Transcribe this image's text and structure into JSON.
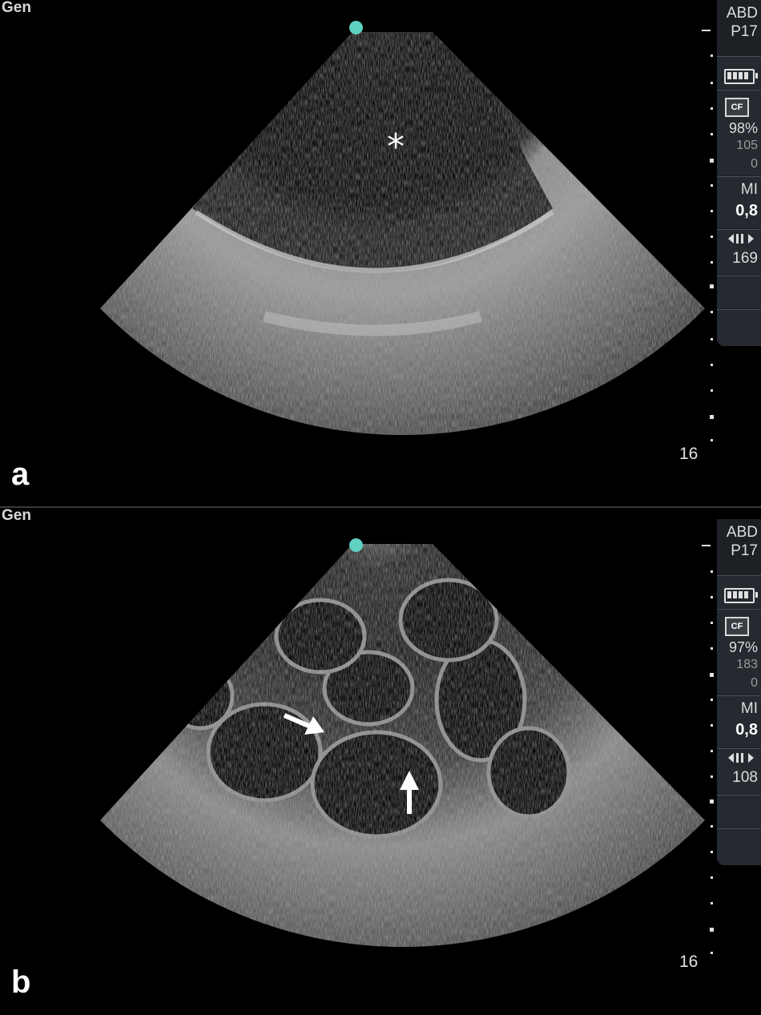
{
  "panels": [
    {
      "letter": "a",
      "mode": "Gen",
      "depth": "16",
      "sidebar": {
        "preset_line1": "ABD",
        "preset_line2": "P17",
        "cf_label": "CF",
        "cf_gain": "98%",
        "cf_value1": "105",
        "cf_value2": "0",
        "mi_label": "MI",
        "mi_value": "0,8",
        "frame_value": "169"
      },
      "annotation_symbol": "*"
    },
    {
      "letter": "b",
      "mode": "Gen",
      "depth": "16",
      "sidebar": {
        "preset_line1": "ABD",
        "preset_line2": "P17",
        "cf_label": "CF",
        "cf_gain": "97%",
        "cf_value1": "183",
        "cf_value2": "0",
        "mi_label": "MI",
        "mi_value": "0,8",
        "frame_value": "108"
      },
      "annotations": [
        "arrow-right",
        "arrow-up"
      ]
    }
  ],
  "colors": {
    "orientation_marker": "#5fd1c0",
    "sidebar_bg": "#1d2126"
  }
}
